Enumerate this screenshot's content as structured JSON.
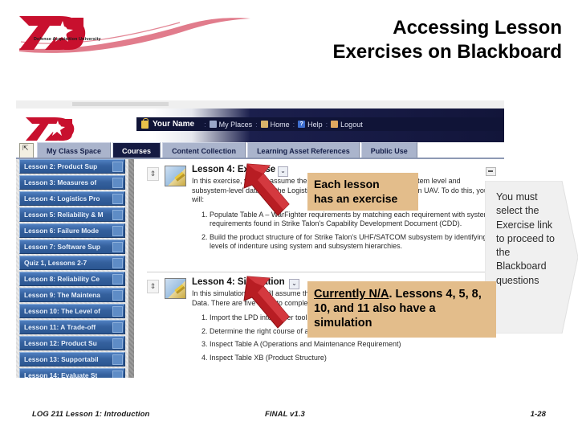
{
  "slide": {
    "title_line1": "Accessing Lesson",
    "title_line2": "Exercises on Blackboard"
  },
  "logo": {
    "acronym": "DAU",
    "subtitle": "Defense Acquisition University",
    "brand_color": "#C8102E"
  },
  "blackboard": {
    "user_label": "Your Name",
    "nav_items": [
      {
        "label": "My Places",
        "icon": "places-icon"
      },
      {
        "label": "Home",
        "icon": "home-icon"
      },
      {
        "label": "Help",
        "icon": "help-icon"
      },
      {
        "label": "Logout",
        "icon": "logout-icon"
      }
    ],
    "tabs": [
      {
        "label": "My Class Space",
        "active": false
      },
      {
        "label": "Courses",
        "active": true
      },
      {
        "label": "Content Collection",
        "active": false
      },
      {
        "label": "Learning Asset References",
        "active": false
      },
      {
        "label": "Public Use",
        "active": false
      }
    ],
    "sidebar_items": [
      {
        "label": "Lesson 2: Product Sup"
      },
      {
        "label": "Lesson 3: Measures of"
      },
      {
        "label": "Lesson 4: Logistics Pro"
      },
      {
        "label": "Lesson 5: Reliability & M"
      },
      {
        "label": "Lesson 6: Failure Mode"
      },
      {
        "label": "Lesson 7: Software Sup"
      },
      {
        "label": "Quiz 1, Lessons 2-7"
      },
      {
        "label": "Lesson 8: Reliability Ce"
      },
      {
        "label": "Lesson 9: The Maintena"
      },
      {
        "label": "Lesson 10: The Level of"
      },
      {
        "label": "Lesson 11: A Trade-off"
      },
      {
        "label": "Lesson 12: Product Su"
      },
      {
        "label": "Lesson 13: Supportabil"
      },
      {
        "label": "Lesson 14: Evaluate St"
      }
    ],
    "modules": [
      {
        "title": "Lesson 4: Exercise",
        "intro": "In this exercise, you will assume the role of a logistician integrating system level and subsystem-level data into the Logistics Product Data for the Strike Talon UAV. To do this, you will:",
        "steps": [
          "Populate Table A – WarFighter requirements by matching each requirement with system requirements found in Strike Talon's Capability Development Document (CDD).",
          "Build the product structure of for Strike Talon's UHF/SATCOM subsystem by identifying levels of indenture using system and subsystem hierarchies."
        ]
      },
      {
        "title": "Lesson 4: Simulation",
        "intro": "In this simulation, you will assume the role of a logistician working with the Logistics Product Data. There are five tasks to complete:",
        "steps": [
          "Import the LPD into power tools",
          "Determine the right course of action",
          "Inspect Table A (Operations and Maintenance Requirement)",
          "Inspect Table XB (Product Structure)"
        ]
      }
    ]
  },
  "callouts": [
    {
      "id": "exercise-callout",
      "line1": "Each lesson",
      "line2": "has an exercise",
      "color": "#e3bd8b"
    },
    {
      "id": "simulation-callout",
      "emphasis": "Currently N/A",
      "rest": ". Lessons 4, 5, 8, 10, and 11 also have a simulation",
      "color": "#e3bd8b"
    }
  ],
  "banner": {
    "text": "You must select the Exercise link to proceed to the Blackboard questions",
    "fill": "#f0f0f0"
  },
  "footer": {
    "left": "LOG 211 Lesson 1: Introduction",
    "center": "FINAL v1.3",
    "right": "1-28"
  }
}
